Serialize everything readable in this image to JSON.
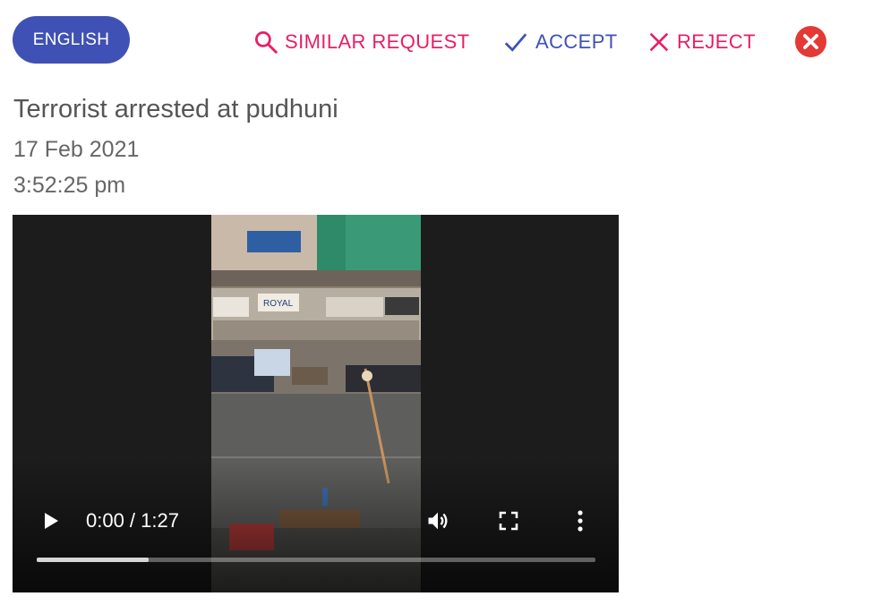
{
  "header": {
    "language_label": "ENGLISH",
    "similar_label": "SIMILAR REQUEST",
    "accept_label": "ACCEPT",
    "reject_label": "REJECT"
  },
  "request": {
    "title": "Terrorist arrested at pudhuni",
    "date": "17 Feb 2021",
    "time": "3:52:25 pm"
  },
  "video": {
    "current_time": "0:00",
    "duration": "1:27",
    "time_display": "0:00 / 1:27",
    "buffered_fraction": 0.2,
    "shop_signs": [
      "ROYAL"
    ]
  },
  "colors": {
    "primary": "#3f51b5",
    "danger": "#e91e63",
    "close_red": "#e53935"
  },
  "icons": [
    "search-icon",
    "check-icon",
    "x-icon",
    "close-circle-icon",
    "play-icon",
    "volume-icon",
    "fullscreen-icon",
    "more-vert-icon"
  ]
}
